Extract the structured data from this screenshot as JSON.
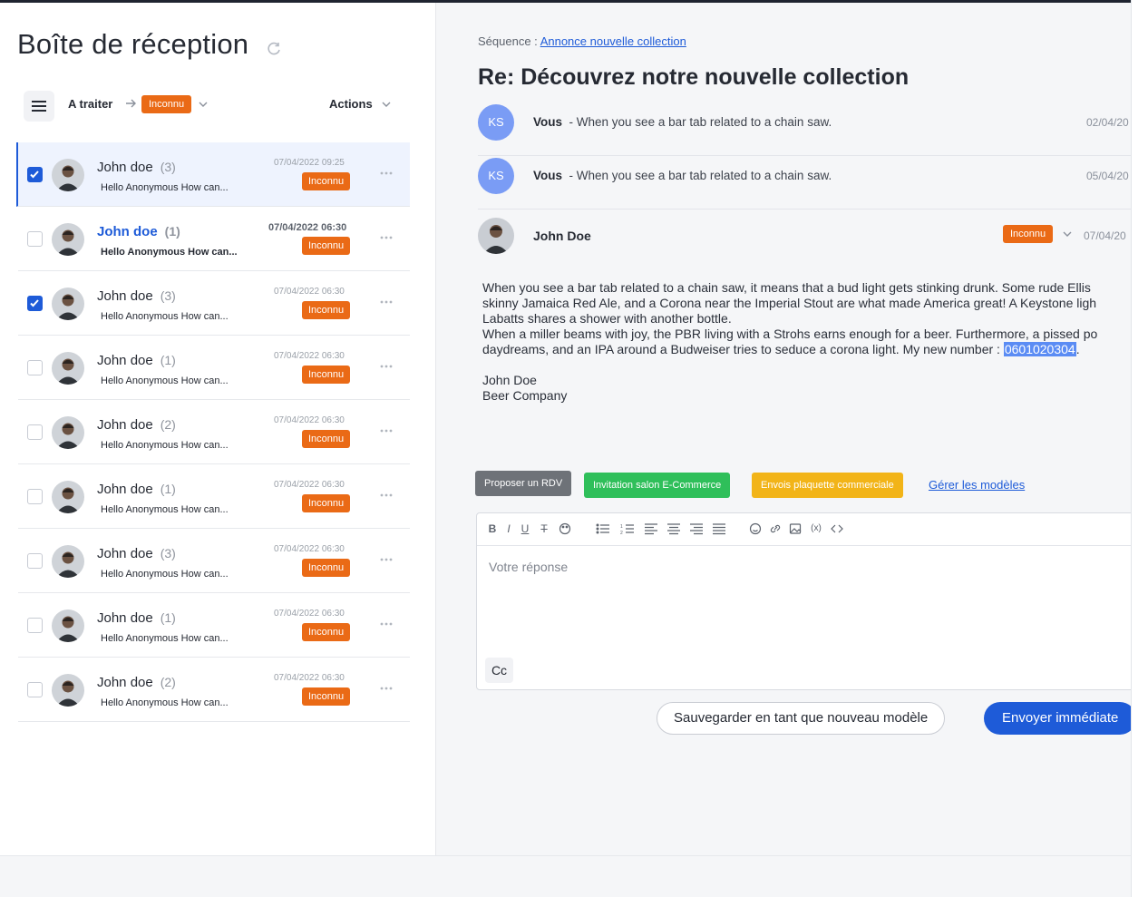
{
  "inbox": {
    "title": "Boîte de réception",
    "filter_label": "A traiter",
    "filter_value": "Inconnu",
    "actions_label": "Actions"
  },
  "messages": [
    {
      "name": "John doe",
      "count": "(3)",
      "preview": "Hello Anonymous How can...",
      "date": "07/04/2022 09:25",
      "badge": "Inconnu",
      "checked": true,
      "selected": true,
      "unread": false
    },
    {
      "name": "John doe",
      "count": "(1)",
      "preview": "Hello Anonymous How can...",
      "date": "07/04/2022 06:30",
      "badge": "Inconnu",
      "checked": false,
      "selected": false,
      "unread": true
    },
    {
      "name": "John doe",
      "count": "(3)",
      "preview": "Hello Anonymous How can...",
      "date": "07/04/2022 06:30",
      "badge": "Inconnu",
      "checked": true,
      "selected": false,
      "unread": false
    },
    {
      "name": "John doe",
      "count": "(1)",
      "preview": "Hello Anonymous How can...",
      "date": "07/04/2022 06:30",
      "badge": "Inconnu",
      "checked": false,
      "selected": false,
      "unread": false
    },
    {
      "name": "John doe",
      "count": "(2)",
      "preview": "Hello Anonymous How can...",
      "date": "07/04/2022 06:30",
      "badge": "Inconnu",
      "checked": false,
      "selected": false,
      "unread": false
    },
    {
      "name": "John doe",
      "count": "(1)",
      "preview": "Hello Anonymous How can...",
      "date": "07/04/2022 06:30",
      "badge": "Inconnu",
      "checked": false,
      "selected": false,
      "unread": false
    },
    {
      "name": "John doe",
      "count": "(3)",
      "preview": "Hello Anonymous How can...",
      "date": "07/04/2022 06:30",
      "badge": "Inconnu",
      "checked": false,
      "selected": false,
      "unread": false
    },
    {
      "name": "John doe",
      "count": "(1)",
      "preview": "Hello Anonymous How can...",
      "date": "07/04/2022 06:30",
      "badge": "Inconnu",
      "checked": false,
      "selected": false,
      "unread": false
    },
    {
      "name": "John doe",
      "count": "(2)",
      "preview": "Hello Anonymous How can...",
      "date": "07/04/2022 06:30",
      "badge": "Inconnu",
      "checked": false,
      "selected": false,
      "unread": false
    }
  ],
  "detail": {
    "sequence_label": "Séquence :",
    "sequence_link": "Annonce nouvelle collection",
    "subject": "Re: Découvrez notre nouvelle collection",
    "thread": [
      {
        "initials": "KS",
        "sender": "Vous",
        "snippet": "- When you see a bar tab related to a chain saw.",
        "date": "02/04/20"
      },
      {
        "initials": "KS",
        "sender": "Vous",
        "snippet": "- When you see a bar tab related to a chain saw.",
        "date": "05/04/20"
      }
    ],
    "expanded": {
      "sender": "John Doe",
      "badge": "Inconnu",
      "date": "07/04/20",
      "body_lines": [
        "When you see a bar tab related to a chain saw, it means that a bud light gets stinking drunk. Some rude Ellis",
        "skinny Jamaica Red Ale, and a Corona near the Imperial Stout are what made America great! A Keystone ligh",
        "Labatts shares a shower with another bottle.",
        "When a miller beams with joy, the PBR living with a Strohs earns enough for a beer. Furthermore, a pissed po"
      ],
      "last_line_prefix": "daydreams, and an IPA around a Budweiser tries to seduce a corona light. My new number : ",
      "phone": "0601020304",
      "last_line_suffix": ".",
      "signature_name": "John Doe",
      "signature_company": "Beer Company"
    },
    "templates": {
      "btn1": "Proposer un RDV",
      "btn2": "Invitation salon E-Commerce",
      "btn3": "Envois plaquette commerciale",
      "manage": "Gérer les modèles"
    },
    "editor": {
      "placeholder": "Votre réponse",
      "cc": "Cc"
    },
    "save_template": "Sauvegarder en tant que nouveau modèle",
    "send": "Envoyer immédiate"
  },
  "colors": {
    "accent": "#1e5bd8",
    "badge": "#ea6a16",
    "avatar_ks": "#7a9cf5"
  }
}
